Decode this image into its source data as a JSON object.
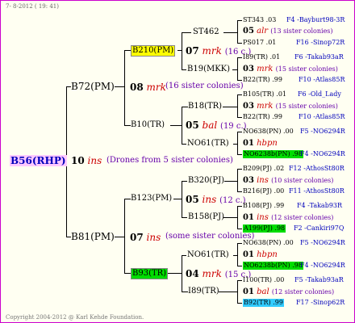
{
  "header": "7- 8-2012 ( 19: 41)",
  "footer": "Copyright 2004-2012 @ Karl Kehde Foundation.",
  "root": {
    "name": "B56(RHP)",
    "num": "10",
    "mark": "ins",
    "desc": "(Drones from 5 sister colonies)"
  },
  "gen1": [
    {
      "name": "B72(PM)",
      "num": "08",
      "mark": "mrk",
      "desc": "(16 sister colonies)"
    },
    {
      "name": "B81(PM)",
      "num": "07",
      "mark": "ins",
      "desc": "(some sister colonies)"
    }
  ],
  "gen2": [
    {
      "name": "B210(PM)",
      "num": "07",
      "mark": "mrk",
      "desc": "(16 c.)"
    },
    {
      "name": "B10(TR)",
      "num": "05",
      "mark": "bal",
      "desc": "(19 c.)"
    },
    {
      "name": "B123(PM)",
      "num": "05",
      "mark": "ins",
      "desc": "(12 c.)"
    },
    {
      "name": "B93(TR)",
      "num": "04",
      "mark": "mrk",
      "desc": "(15 c.)"
    }
  ],
  "gen3": [
    "ST462",
    "B19(MKK)",
    "B18(TR)",
    "NO61(TR)",
    "B320(PJ)",
    "B158(PJ)",
    "NO61(TR)",
    "I89(TR)"
  ],
  "gen4": [
    {
      "top": "ST343 .03",
      "top_r": "F4 -Bayburt98-3R",
      "num": "05",
      "mark": "alr",
      "desc": "(13 sister colonies)",
      "bot": "PS017 .01",
      "bot_r": "F16 -Sinop72R"
    },
    {
      "top": "I89(TR) .01",
      "top_r": "F6 -Takab93aR",
      "num": "03",
      "mark": "mrk",
      "desc": "(15 sister colonies)",
      "bot": "B22(TR) .99",
      "bot_r": "F10 -Atlas85R"
    },
    {
      "top": "B105(TR) .01",
      "top_r": "F6 -Old_Lady",
      "num": "03",
      "mark": "mrk",
      "desc": "(15 sister colonies)",
      "bot": "B22(TR) .99",
      "bot_r": "F10 -Atlas85R"
    },
    {
      "top": "NO638(PN) .00",
      "top_r": "F5 -NO6294R",
      "num": "01",
      "mark": "hbpn",
      "desc": "",
      "bot": "NO6238b(PN) .98",
      "bot_r": "F4 -NO6294R"
    },
    {
      "top": "B209(PJ) .02",
      "top_r": "F12 -AthosSt80R",
      "num": "03",
      "mark": "ins",
      "desc": "(10 sister colonies)",
      "bot": "B216(PJ) .00",
      "bot_r": "F11 -AthosSt80R"
    },
    {
      "top": "B108(PJ) .99",
      "top_r": "F4 -Takab93R",
      "num": "01",
      "mark": "ins",
      "desc": "(12 sister colonies)",
      "bot": "A199(PJ) .98",
      "bot_r": "F2 -Cankiri97Q"
    },
    {
      "top": "NO638(PN) .00",
      "top_r": "F5 -NO6294R",
      "num": "01",
      "mark": "hbpn",
      "desc": "",
      "bot": "NO6238b(PN) .98",
      "bot_r": "F4 -NO6294R"
    },
    {
      "top": "I100(TR) .00",
      "top_r": "F5 -Takab93aR",
      "num": "01",
      "mark": "bal",
      "desc": "(12 sister colonies)",
      "bot": "B92(TR) .99",
      "bot_r": "F17 -Sinop62R"
    }
  ]
}
